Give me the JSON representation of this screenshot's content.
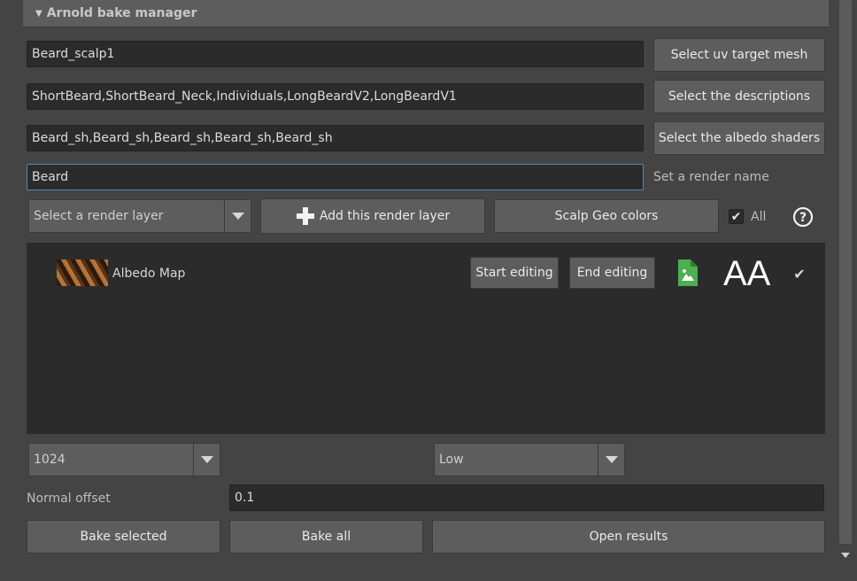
{
  "panel": {
    "title": "Arnold bake manager"
  },
  "uv_target": {
    "value": "Beard_scalp1",
    "button": "Select uv target mesh"
  },
  "descriptions": {
    "value": "ShortBeard,ShortBeard_Neck,Individuals,LongBeardV2,LongBeardV1",
    "button": "Select the descriptions"
  },
  "albedo_shaders": {
    "value": "Beard_sh,Beard_sh,Beard_sh,Beard_sh,Beard_sh",
    "button": "Select the albedo shaders"
  },
  "render_name": {
    "value": "Beard",
    "label": "Set a render name"
  },
  "render_layer": {
    "select_placeholder": "Select a render layer",
    "add_button": "Add this render layer",
    "scalp_button": "Scalp Geo colors",
    "all_label": "All",
    "all_checked": true
  },
  "layers": [
    {
      "name": "Albedo Map",
      "start_label": "Start editing",
      "end_label": "End editing",
      "aa_label": "AA",
      "checked": true
    }
  ],
  "resolution": {
    "value": "1024"
  },
  "quality": {
    "value": "Low"
  },
  "normal_offset": {
    "label": "Normal offset",
    "value": "0.1"
  },
  "actions": {
    "bake_selected": "Bake selected",
    "bake_all": "Bake all",
    "open_results": "Open results"
  },
  "colors": {
    "accent": "#5a86ad",
    "file_icon": "#4caf50"
  }
}
